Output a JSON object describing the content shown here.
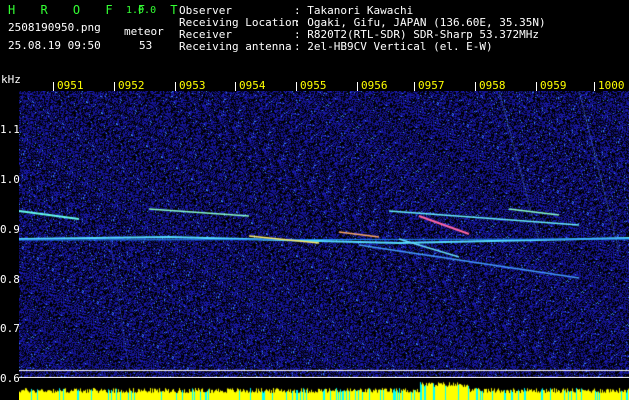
{
  "app": {
    "name": "H R O F F T",
    "version": "1.0.0"
  },
  "file": {
    "name": "2508190950.png",
    "datetime": "25.08.19 09:50"
  },
  "detection": {
    "label": "meteor",
    "count": "53"
  },
  "info": {
    "rows": [
      {
        "key": "Observer",
        "value": ": Takanori Kawachi"
      },
      {
        "key": "Receiving Location",
        "value": ": Ogaki, Gifu, JAPAN (136.60E, 35.35N)"
      },
      {
        "key": "Receiver",
        "value": ": R820T2(RTL-SDR) SDR-Sharp 53.372MHz"
      },
      {
        "key": "Receiving antenna",
        "value": ": 2el-HB9CV Vertical (el. E-W)"
      }
    ]
  },
  "axis": {
    "unit": "kHz",
    "time_labels": [
      "0951",
      "0952",
      "0953",
      "0954",
      "0955",
      "0956",
      "0957",
      "0958",
      "0959",
      "1000"
    ],
    "freq_labels": [
      "1.1",
      "1.0",
      "0.9",
      "0.8",
      "0.7",
      "0.6"
    ]
  },
  "colors": {
    "background": "#000000",
    "text_white": "#ffffff",
    "text_green": "#33ff33",
    "text_yellow": "#ffff00",
    "noise_blue": "#1a1aa0",
    "trace_cyan": "#33ccff",
    "spectrum_yellow": "#ffff00",
    "spectrum_cyan": "#00ffff"
  }
}
